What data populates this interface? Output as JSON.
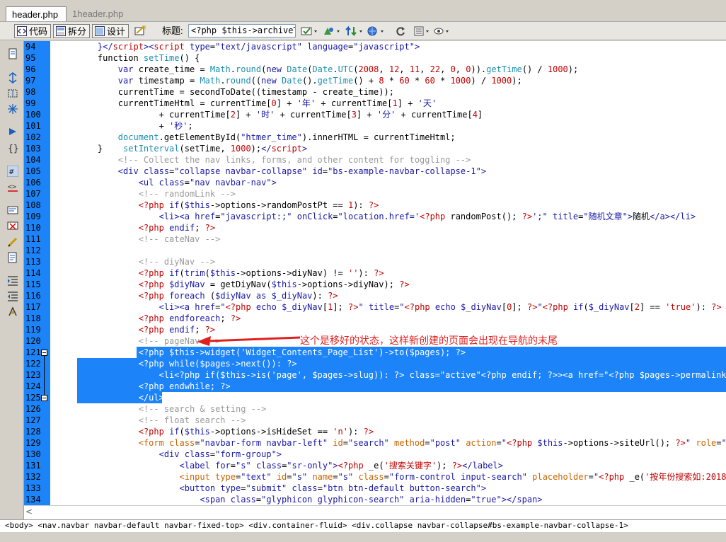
{
  "tabs": [
    {
      "label": "header.php",
      "active": true
    },
    {
      "label": "1header.php",
      "active": false
    }
  ],
  "toolbar": {
    "code_label": "代码",
    "split_label": "拆分",
    "design_label": "设计",
    "title_label": "标题:",
    "title_value": "<?php $this->archiveTitle"
  },
  "editor": {
    "line_numbers": [
      "94",
      "95",
      "96",
      "97",
      "98",
      "99",
      "100",
      "101",
      "102",
      "103",
      "104",
      "105",
      "106",
      "107",
      "108",
      "109",
      "110",
      "111",
      "112",
      "113",
      "114",
      "115",
      "116",
      "117",
      "118",
      "119",
      "120",
      "121",
      "122",
      "123",
      "124",
      "125",
      "126",
      "127",
      "128",
      "129",
      "130",
      "131",
      "132",
      "133",
      "134"
    ],
    "annotation": "这个是移好的状态，这样新创建的页面会出现在导航的末尾",
    "selection_start_line": 121,
    "selection_end_line": 125
  },
  "pathbar": {
    "path": "<body> <nav.navbar navbar-default navbar-fixed-top> <div.container-fluid> <div.collapse navbar-collapse#bs-example-navbar-collapse-1>"
  },
  "hscroll": {
    "arrow": "<"
  },
  "colors": {
    "selection": "#1c84f8",
    "annotation": "#e02020"
  }
}
